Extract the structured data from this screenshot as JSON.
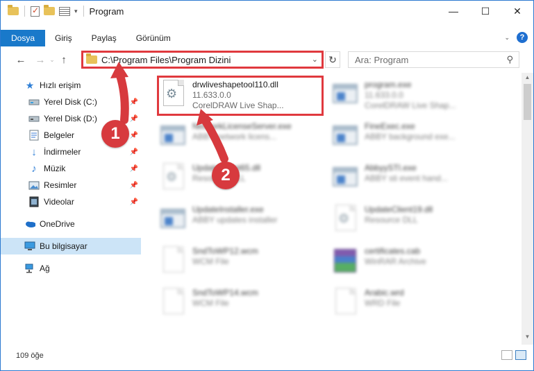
{
  "window": {
    "title": "Program",
    "controls": {
      "minimize": "—",
      "maximize": "☐",
      "close": "✕"
    }
  },
  "ribbon": {
    "file_tab": "Dosya",
    "tabs": [
      "Giriş",
      "Paylaş",
      "Görünüm"
    ],
    "help": "?"
  },
  "address_bar": {
    "path": "C:\\Program Files\\Program Dizini",
    "refresh_glyph": "↻",
    "dropdown_glyph": "⌄"
  },
  "search": {
    "placeholder": "Ara: Program"
  },
  "nav": {
    "back": "←",
    "forward": "→",
    "up": "↑",
    "recent": "⌄",
    "quick_access": "Hızlı erişim",
    "items": [
      {
        "label": "Yerel Disk (C:)",
        "icon": "drive-icon"
      },
      {
        "label": "Yerel Disk (D:)",
        "icon": "drive-icon"
      },
      {
        "label": "Belgeler",
        "icon": "documents-icon"
      },
      {
        "label": "İndirmeler",
        "icon": "download-icon"
      },
      {
        "label": "Müzik",
        "icon": "music-icon"
      },
      {
        "label": "Resimler",
        "icon": "pictures-icon"
      },
      {
        "label": "Videolar",
        "icon": "videos-icon"
      }
    ],
    "onedrive": "OneDrive",
    "this_pc": "Bu bilgisayar",
    "network": "Ağ"
  },
  "files": [
    {
      "name": "drwliveshapetool110.dll",
      "sub1": "11.633.0.0",
      "sub2": "CorelDRAW Live Shap...",
      "icon": "dll-icon"
    },
    {
      "name": "program.exe",
      "sub1": "11.633.0.0",
      "sub2": "CorelDRAW Live Shap...",
      "icon": "exe-icon"
    },
    {
      "name": "NetworkLicenseServer.exe",
      "sub1": "ABBY network licens...",
      "sub2": "",
      "icon": "exe-icon"
    },
    {
      "name": "FineExec.exe",
      "sub1": "ABBY background exe...",
      "sub2": "",
      "icon": "exe-icon"
    },
    {
      "name": "UpdateClient65.dll",
      "sub1": "Resource DLL",
      "sub2": "",
      "icon": "dll-icon"
    },
    {
      "name": "AbbyySTI.exe",
      "sub1": "ABBY sti event hand...",
      "sub2": "",
      "icon": "exe-icon"
    },
    {
      "name": "UpdateInstaller.exe",
      "sub1": "ABBY updates installer",
      "sub2": "",
      "icon": "exe-icon"
    },
    {
      "name": "UpdateClient19.dll",
      "sub1": "Resource DLL",
      "sub2": "",
      "icon": "dll-icon"
    },
    {
      "name": "SndToWP12.wcm",
      "sub1": "WCM File",
      "sub2": "",
      "icon": "file-icon"
    },
    {
      "name": "certificates.cab",
      "sub1": "WinRAR Archive",
      "sub2": "",
      "icon": "archive-icon"
    },
    {
      "name": "SndToWP14.wcm",
      "sub1": "WCM File",
      "sub2": "",
      "icon": "file-icon"
    },
    {
      "name": "Arabic.wrd",
      "sub1": "WRD File",
      "sub2": "",
      "icon": "file-icon"
    }
  ],
  "markers": [
    "1",
    "2"
  ],
  "status": {
    "count": "109 öğe"
  },
  "colors": {
    "accent": "#1979ca",
    "highlight": "#e0393e",
    "selected": "#cce4f7"
  }
}
